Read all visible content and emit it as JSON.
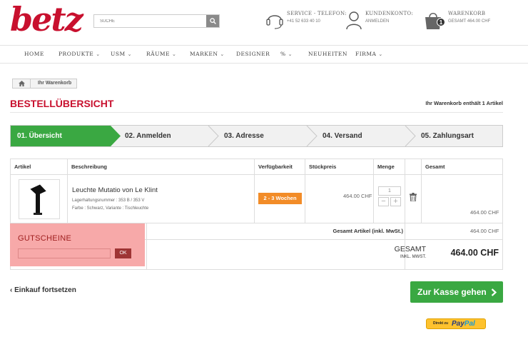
{
  "brand": {
    "logo": "betz",
    "color": "#c8102e"
  },
  "search": {
    "placeholder": "SUCHE"
  },
  "header": {
    "service_label": "SERVICE - TELEFON:",
    "service_phone": "+41 52 633 40 10",
    "account_label": "KUNDENKONTO:",
    "account_sub": "ANMELDEN",
    "cart_label": "WARENKORB",
    "cart_total": "GESAMT 464.00 CHF",
    "cart_count": "1"
  },
  "nav": {
    "items": [
      {
        "label": "HOME",
        "dropdown": false
      },
      {
        "label": "PRODUKTE",
        "dropdown": true
      },
      {
        "label": "USM",
        "dropdown": true
      },
      {
        "label": "RÄUME",
        "dropdown": true
      },
      {
        "label": "MARKEN",
        "dropdown": true
      },
      {
        "label": "DESIGNER",
        "dropdown": false
      },
      {
        "label": "%",
        "dropdown": true
      },
      {
        "label": "NEUHEITEN",
        "dropdown": false
      },
      {
        "label": "FIRMA",
        "dropdown": true
      }
    ]
  },
  "breadcrumb": {
    "current": "Ihr Warenkorb"
  },
  "page": {
    "title": "BESTELLÜBERSICHT",
    "cart_info": "Ihr Warenkorb enthält 1 Artikel"
  },
  "steps": [
    {
      "label": "01. Übersicht",
      "active": true
    },
    {
      "label": "02. Anmelden",
      "active": false
    },
    {
      "label": "03. Adresse",
      "active": false
    },
    {
      "label": "04. Versand",
      "active": false
    },
    {
      "label": "05. Zahlungsart",
      "active": false
    }
  ],
  "colors": {
    "step_active": "#3aa842",
    "availability": "#f28c28",
    "checkout": "#3aa842",
    "voucher_bg": "#f7a9a9"
  },
  "table": {
    "headers": [
      "Artikel",
      "Beschreibung",
      "Verfügbarkeit",
      "Stückpreis",
      "Menge",
      "",
      "Gesamt"
    ],
    "items": [
      {
        "name": "Leuchte Mutatio von Le Klint",
        "sku": "Lagerhaltungsnummer : 353 B / 353 V",
        "variant": "Farbe : Schwarz, Variante : Tischleuchte",
        "availability": "2 - 3 Wochen",
        "unit_price": "464.00 CHF",
        "quantity": "1",
        "total": "464.00 CHF"
      }
    ],
    "subtotal_label": "Gesamt Artikel (inkl. MwSt.)",
    "subtotal_value": "464.00 CHF",
    "total_label": "GESAMT",
    "total_sub": "INKL. MWST.",
    "total_value": "464.00 CHF"
  },
  "voucher": {
    "label": "GUTSCHEINE",
    "ok_label": "OK"
  },
  "actions": {
    "continue_label": "Einkauf fortsetzen",
    "checkout_label": "Zur Kasse gehen",
    "paypal_prefix": "Direkt zu",
    "paypal_brand_1": "Pay",
    "paypal_brand_2": "Pal"
  }
}
